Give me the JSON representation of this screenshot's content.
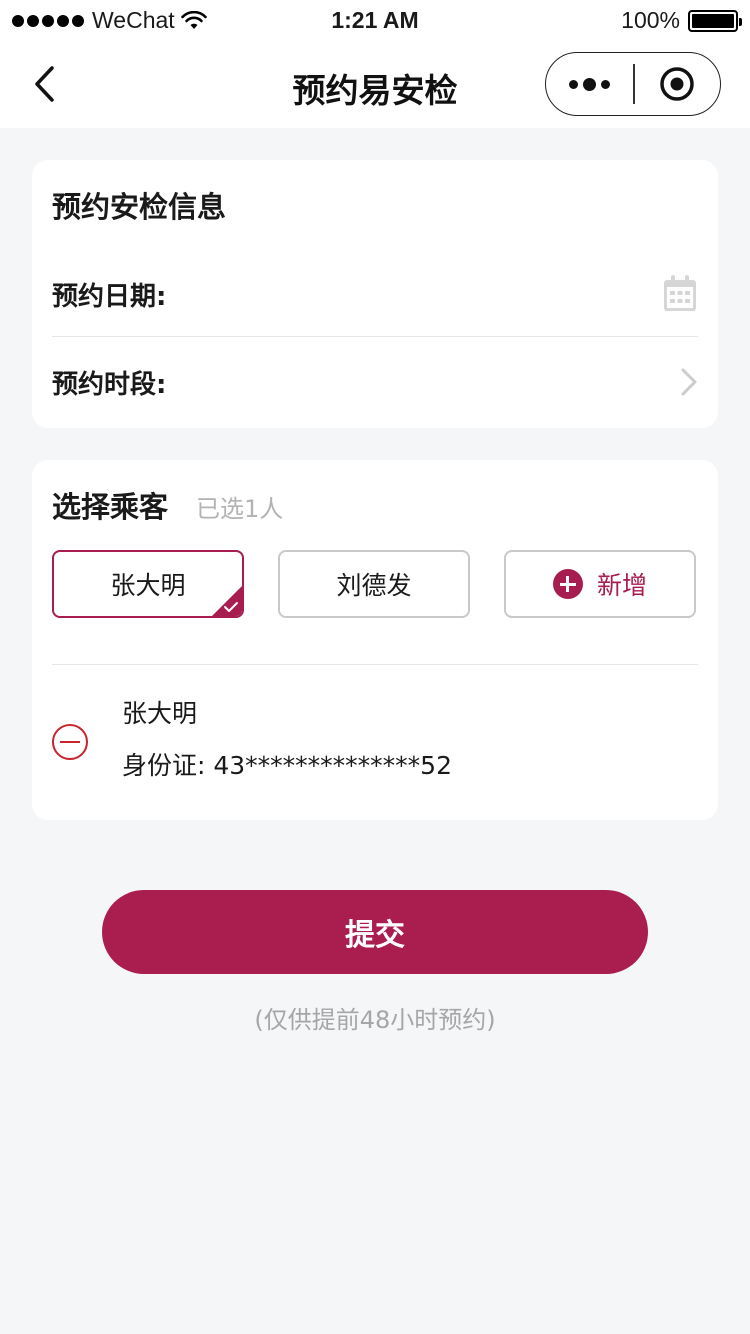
{
  "status_bar": {
    "carrier": "WeChat",
    "time": "1:21 AM",
    "battery": "100%"
  },
  "nav": {
    "title": "预约易安检"
  },
  "info_card": {
    "title": "预约安检信息",
    "date_label": "预约日期:",
    "slot_label": "预约时段:"
  },
  "passenger_card": {
    "title": "选择乘客",
    "selected_count": "已选1人",
    "chips": [
      {
        "label": "张大明",
        "selected": true
      },
      {
        "label": "刘德发",
        "selected": false
      }
    ],
    "add_label": "新增",
    "selected_passenger": {
      "name": "张大明",
      "id_text": "身份证: 43**************52"
    }
  },
  "submit_label": "提交",
  "note": "(仅供提前48小时预约)",
  "colors": {
    "accent": "#a81d50",
    "remove": "#c9242e",
    "background": "#f5f6f8"
  }
}
